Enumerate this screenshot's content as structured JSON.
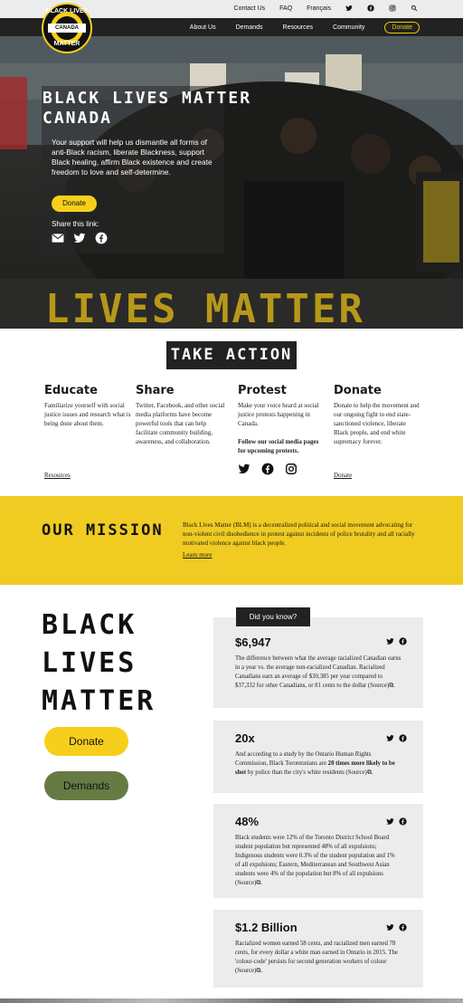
{
  "header": {
    "top_links": [
      "Contact Us",
      "FAQ",
      "Français"
    ],
    "nav": [
      "About Us",
      "Demands",
      "Resources",
      "Community"
    ],
    "nav_donate": "Donate"
  },
  "logo": {
    "top": "BLACK LIVES",
    "middle": "CANADA",
    "bottom": "MATTER"
  },
  "hero": {
    "title_line1": "BLACK LIVES MATTER",
    "title_line2": "CANADA",
    "text": "Your support will help us dismantle all forms of anti-Black racism, liberate Blackness, support Black healing, affirm Black existence and create freedom to love and self-determine.",
    "donate": "Donate",
    "share_label": "Share this link:",
    "banner_text": "LIVES MATTER"
  },
  "take_action": {
    "title": "TAKE ACTION",
    "columns": [
      {
        "heading": "Educate",
        "text": "Familiarize yourself with social justice issues and research what is being done about them.",
        "link": "Resources"
      },
      {
        "heading": "Share",
        "text": "Twitter, Facebook, and other social media platforms have become powerful tools that can help facilitate community building, awareness, and collaboration."
      },
      {
        "heading": "Protest",
        "text": "Make your voice heard at social justice protests happening in Canada.",
        "bold": "Follow our social media pages for upcoming protests."
      },
      {
        "heading": "Donate",
        "text": "Donate to help the movement and our ongoing fight to end state-sanctioned violence, liberate Black people, and end white supremacy forever.",
        "link": "Donate"
      }
    ]
  },
  "mission": {
    "title": "OUR MISSION",
    "text": "Black Lives Matter (BLM) is a decentralized political and social movement advocating for non-violent civil disobedience in protest against incidents of police brutality and all racially motivated violence against black people.",
    "link": "Learn more"
  },
  "blm": {
    "line1": "BLACK",
    "line2": "LIVES",
    "line3": "MATTER",
    "donate": "Donate",
    "demands": "Demands"
  },
  "facts": {
    "tag": "Did you know?",
    "cards": [
      {
        "stat": "$6,947",
        "text": "The difference between what the average racialized Canadian earns in a year vs. the average non-racialized Canadian. Racialized Canadians earn an average of $30,385 per year compared to $37,332 for other Canadians, or 81 cents to the dollar (Source)⧉."
      },
      {
        "stat": "20x",
        "text_pre": "And according to a study by the Ontario Human Rights Commission, Black Torontonians are ",
        "text_bold": "20 times more likely to be shot",
        "text_post": " by police than the city's white residents (Source)⧉."
      },
      {
        "stat": "48%",
        "text": "Black students were 12% of the Toronto District School Board student population but represented 48% of all expulsions; Indigenous students were 0.3% of the student population and 1% of all expulsions; Eastern, Mediterranean and Southwest Asian students were 4% of the population but 8% of all expulsions (Source)⧉."
      },
      {
        "stat": "$1.2 Billion",
        "text": "Racialized women earned 58 cents, and racialized men earned 78 cents, for every dollar a white man earned in Ontario in 2015. The 'colour-code' persists for second generation workers of colour (Source)⧉."
      }
    ]
  },
  "colors": {
    "yellow": "#f0cb21",
    "green": "#667b44",
    "dark": "#222222"
  }
}
